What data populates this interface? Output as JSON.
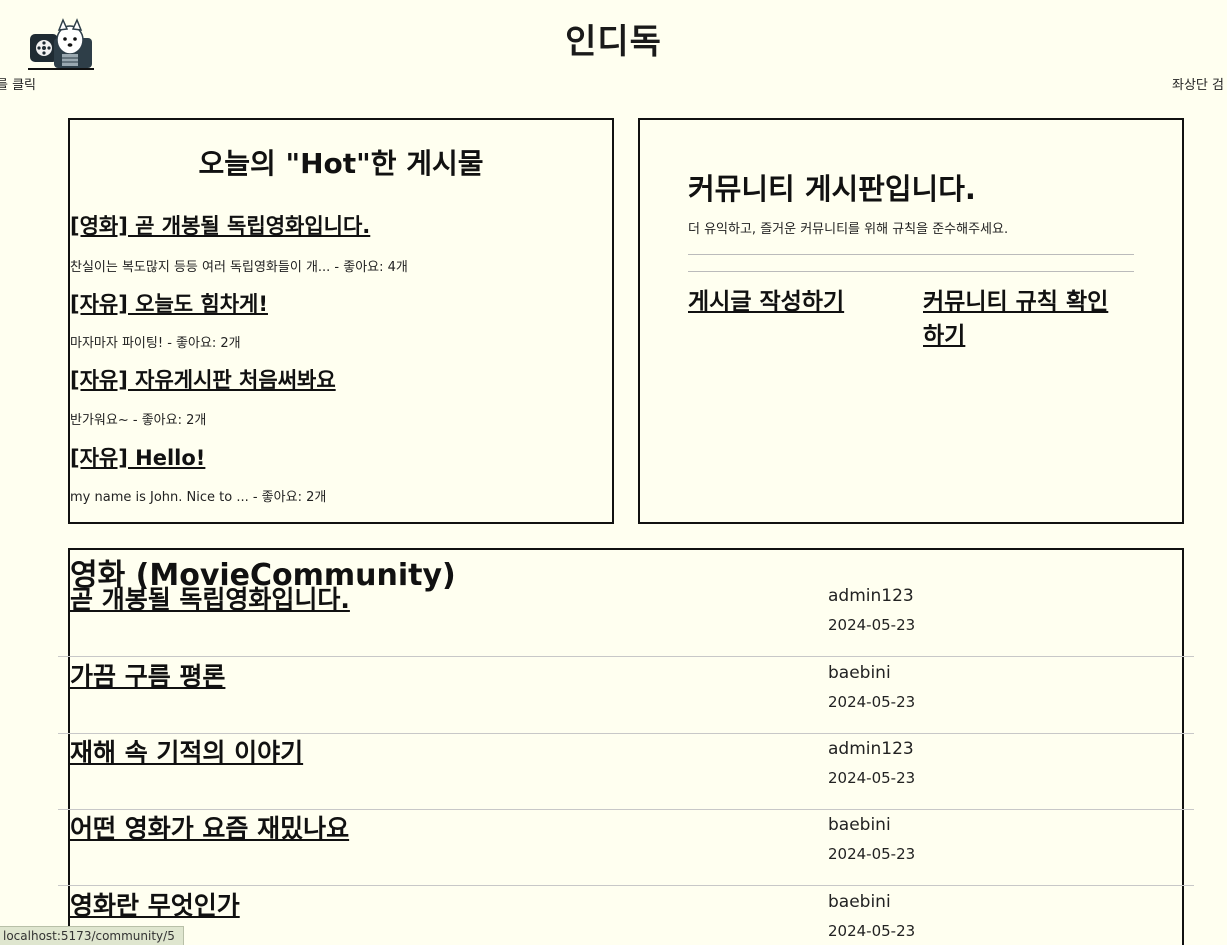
{
  "header": {
    "site_title": "인디독",
    "marquee_left": "를 클릭",
    "marquee_right": "좌상단 검"
  },
  "hot": {
    "title": "오늘의 \"Hot\"한 게시물",
    "items": [
      {
        "title": "[영화] 곧 개봉될 독립영화입니다.",
        "desc": "찬실이는 복도많지 등등 여러 독립영화들이 개... - 좋아요: 4개"
      },
      {
        "title": "[자유] 오늘도 힘차게!",
        "desc": "마자마자 파이팅! - 좋아요: 2개"
      },
      {
        "title": "[자유] 자유게시판 처음써봐요",
        "desc": "반가워요~ - 좋아요: 2개"
      },
      {
        "title": "[자유] Hello!",
        "desc": "my name is John. Nice to ... - 좋아요: 2개"
      }
    ]
  },
  "community": {
    "heading": "커뮤니티 게시판입니다.",
    "subtitle": "더 유익하고, 즐거운 커뮤니티를 위해 규칙을 준수해주세요.",
    "write_link": "게시글 작성하기",
    "rules_link_line1": "커뮤니티 규칙 확인",
    "rules_link_line2": "하기"
  },
  "movie": {
    "title": "영화 (MovieCommunity)",
    "posts": [
      {
        "title": "곧 개봉될 독립영화입니다.",
        "author": "admin123",
        "date": "2024-05-23"
      },
      {
        "title": "가끔 구름 평론",
        "author": "baebini",
        "date": "2024-05-23"
      },
      {
        "title": "재해 속 기적의 이야기",
        "author": "admin123",
        "date": "2024-05-23"
      },
      {
        "title": "어떤 영화가 요즘 재밌나요",
        "author": "baebini",
        "date": "2024-05-23"
      },
      {
        "title": "영화란 무엇인가",
        "author": "baebini",
        "date": "2024-05-23"
      }
    ]
  },
  "status_bar": {
    "url": "localhost:5173/community/5"
  },
  "colors": {
    "background": "#fffff0",
    "border": "#111111",
    "status_bg": "#dfe6cf"
  },
  "icons": {
    "logo": "dog-with-film-reel-logo"
  }
}
